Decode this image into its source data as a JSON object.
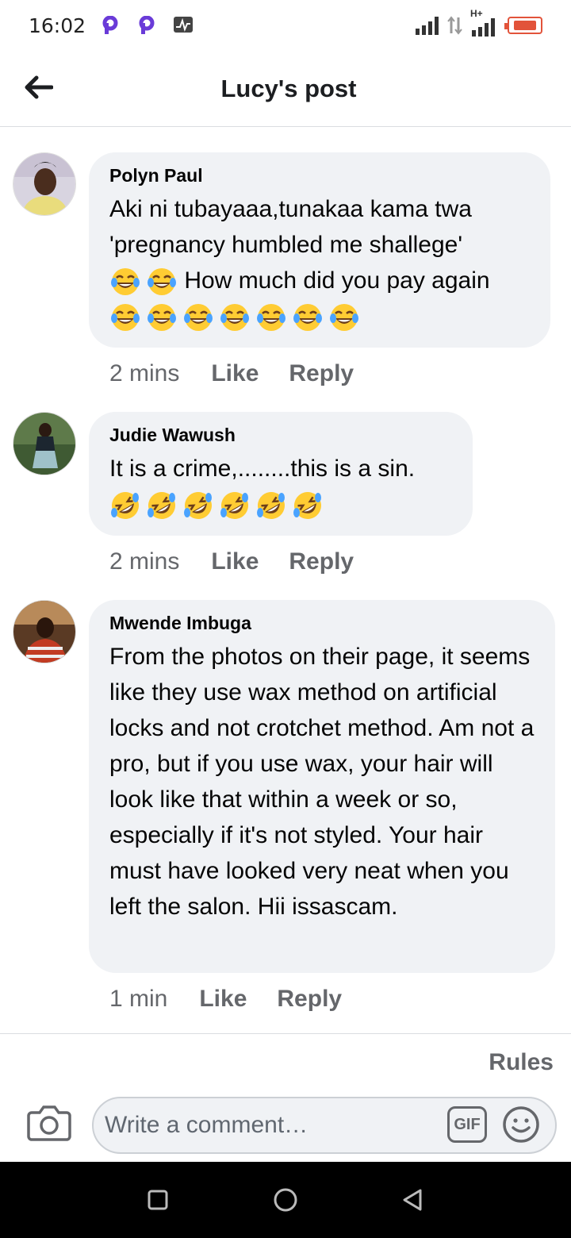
{
  "status_bar": {
    "time": "16:02",
    "app_icons": [
      "p-icon",
      "p-icon",
      "activity-icon"
    ],
    "network_label": "H+",
    "battery_color": "#e2533a"
  },
  "header": {
    "title": "Lucy's post",
    "back_icon": "back-arrow-icon"
  },
  "comments": [
    {
      "author": "Polyn Paul",
      "text": "Aki ni tubayaaa,tunakaa kama twa 'pregnancy humbled me shallege'",
      "text_after_emoji": "How much did you pay again",
      "emoji": "tears-of-joy-icon",
      "time": "2 mins",
      "like": "Like",
      "reply": "Reply"
    },
    {
      "author": "Judie Wawush",
      "text": "It is a crime,........this is a sin.",
      "emoji": "rolling-on-floor-laughing-icon",
      "time": "2 mins",
      "like": "Like",
      "reply": "Reply"
    },
    {
      "author": "Mwende Imbuga",
      "text": "From the photos on their page, it seems like they use wax method on artificial locks and not crotchet method. Am not a pro, but if you use wax, your hair will look like that within a week or so, especially if it's not styled. Your hair must have looked very neat when you left the salon. Hii issascam.",
      "time": "1 min",
      "like": "Like",
      "reply": "Reply"
    }
  ],
  "footer": {
    "rules": "Rules",
    "composer_placeholder": "Write a comment…",
    "gif_label": "GIF",
    "camera_icon": "camera-icon",
    "emoji_icon": "smiley-icon"
  },
  "nav": {
    "icons": [
      "recents-square-icon",
      "home-circle-icon",
      "back-triangle-icon"
    ]
  },
  "colors": {
    "bubble": "#f0f2f5",
    "meta_text": "#65676b",
    "emoji_face": "#ffcc33"
  }
}
